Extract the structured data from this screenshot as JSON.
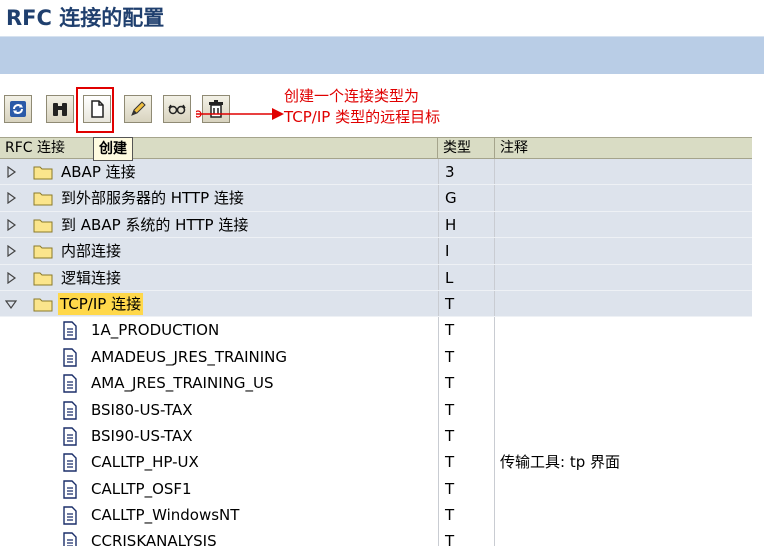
{
  "window": {
    "title": "RFC 连接的配置"
  },
  "toolbar": {
    "buttons": [
      {
        "name": "refresh-button",
        "icon": "refresh-icon"
      },
      {
        "name": "find-button",
        "icon": "binoculars-icon"
      },
      {
        "name": "create-button",
        "icon": "new-document-icon"
      },
      {
        "name": "change-button",
        "icon": "pencil-icon"
      },
      {
        "name": "copy-button",
        "icon": "glasses-icon"
      },
      {
        "name": "delete-button",
        "icon": "trash-icon"
      }
    ],
    "tooltip": "创建"
  },
  "annotation": {
    "line1": "创建一个连接类型为",
    "line2": "TCP/IP 类型的远程目标",
    "color": "#e00000"
  },
  "table": {
    "headers": {
      "name": "RFC 连接",
      "type": "类型",
      "note": "注释"
    },
    "rows": [
      {
        "kind": "folder",
        "name": "ABAP 连接",
        "type": "3",
        "note": "",
        "expanded": false
      },
      {
        "kind": "folder",
        "name": "到外部服务器的 HTTP 连接",
        "type": "G",
        "note": "",
        "expanded": false
      },
      {
        "kind": "folder",
        "name": "到 ABAP 系统的 HTTP 连接",
        "type": "H",
        "note": "",
        "expanded": false
      },
      {
        "kind": "folder",
        "name": "内部连接",
        "type": "I",
        "note": "",
        "expanded": false
      },
      {
        "kind": "folder",
        "name": "逻辑连接",
        "type": "L",
        "note": "",
        "expanded": false
      },
      {
        "kind": "folder",
        "name": "TCP/IP 连接",
        "type": "T",
        "note": "",
        "expanded": true,
        "selected": true
      },
      {
        "kind": "leaf",
        "name": "1A_PRODUCTION",
        "type": "T",
        "note": ""
      },
      {
        "kind": "leaf",
        "name": "AMADEUS_JRES_TRAINING",
        "type": "T",
        "note": ""
      },
      {
        "kind": "leaf",
        "name": "AMA_JRES_TRAINING_US",
        "type": "T",
        "note": ""
      },
      {
        "kind": "leaf",
        "name": "BSI80-US-TAX",
        "type": "T",
        "note": ""
      },
      {
        "kind": "leaf",
        "name": "BSI90-US-TAX",
        "type": "T",
        "note": ""
      },
      {
        "kind": "leaf",
        "name": "CALLTP_HP-UX",
        "type": "T",
        "note": "传输工具: tp 界面"
      },
      {
        "kind": "leaf",
        "name": "CALLTP_OSF1",
        "type": "T",
        "note": ""
      },
      {
        "kind": "leaf",
        "name": "CALLTP_WindowsNT",
        "type": "T",
        "note": ""
      },
      {
        "kind": "leaf",
        "name": "CCRISKANALYSIS",
        "type": "T",
        "note": ""
      }
    ]
  },
  "colors": {
    "band": "#b9cde6",
    "folder_row": "#dde3ec",
    "header": "#d9dcc4",
    "selected": "#ffd84a",
    "title": "#1f3f6e"
  }
}
